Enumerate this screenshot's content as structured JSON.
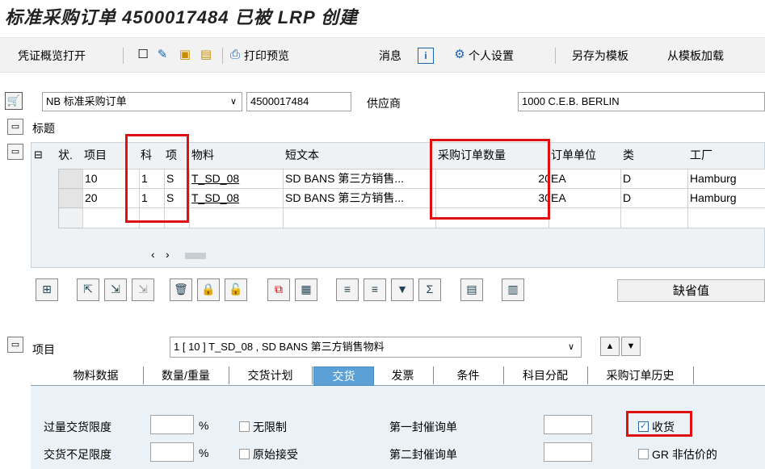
{
  "title": "标准采购订单 4500017484 已被 LRP 创建",
  "toolbar": {
    "doc_overview": "凭证概览打开",
    "print_preview": "打印预览",
    "messages": "消息",
    "personal_settings": "个人设置",
    "save_as_template": "另存为模板",
    "load_from_template": "从模板加载"
  },
  "header": {
    "doc_type": "NB 标准采购订单",
    "po_number": "4500017484",
    "vendor_label": "供应商",
    "vendor_value": "1000 C.E.B. BERLIN",
    "section_title": "标题"
  },
  "grid": {
    "columns": [
      "状.",
      "项目",
      "科",
      "项",
      "物料",
      "短文本",
      "采购订单数量",
      "订单单位",
      "类",
      "工厂"
    ],
    "rows": [
      {
        "item": "10",
        "acct": "1",
        "cat": "S",
        "material": "T_SD_08",
        "short_text": "SD BANS 第三方销售...",
        "qty": "20",
        "unit": "EA",
        "type": "D",
        "plant": "Hamburg"
      },
      {
        "item": "20",
        "acct": "1",
        "cat": "S",
        "material": "T_SD_08",
        "short_text": "SD BANS 第三方销售...",
        "qty": "30",
        "unit": "EA",
        "type": "D",
        "plant": "Hamburg"
      }
    ]
  },
  "actions": {
    "default_values": "缺省值"
  },
  "item_section": {
    "label": "项目",
    "selector": "1 [ 10 ] T_SD_08 , SD BANS 第三方销售物料"
  },
  "tabs": [
    "物料数据",
    "数量/重量",
    "交货计划",
    "交货",
    "发票",
    "条件",
    "科目分配",
    "采购订单历史"
  ],
  "delivery": {
    "overdelivery": "过量交货限度",
    "underdelivery": "交货不足限度",
    "percent": "%",
    "unlimited": "无限制",
    "original_accept": "原始接受",
    "reminder1": "第一封催询单",
    "reminder2": "第二封催询单",
    "goods_receipt": "收货",
    "gr_non_valuated": "GR 非估价的"
  }
}
